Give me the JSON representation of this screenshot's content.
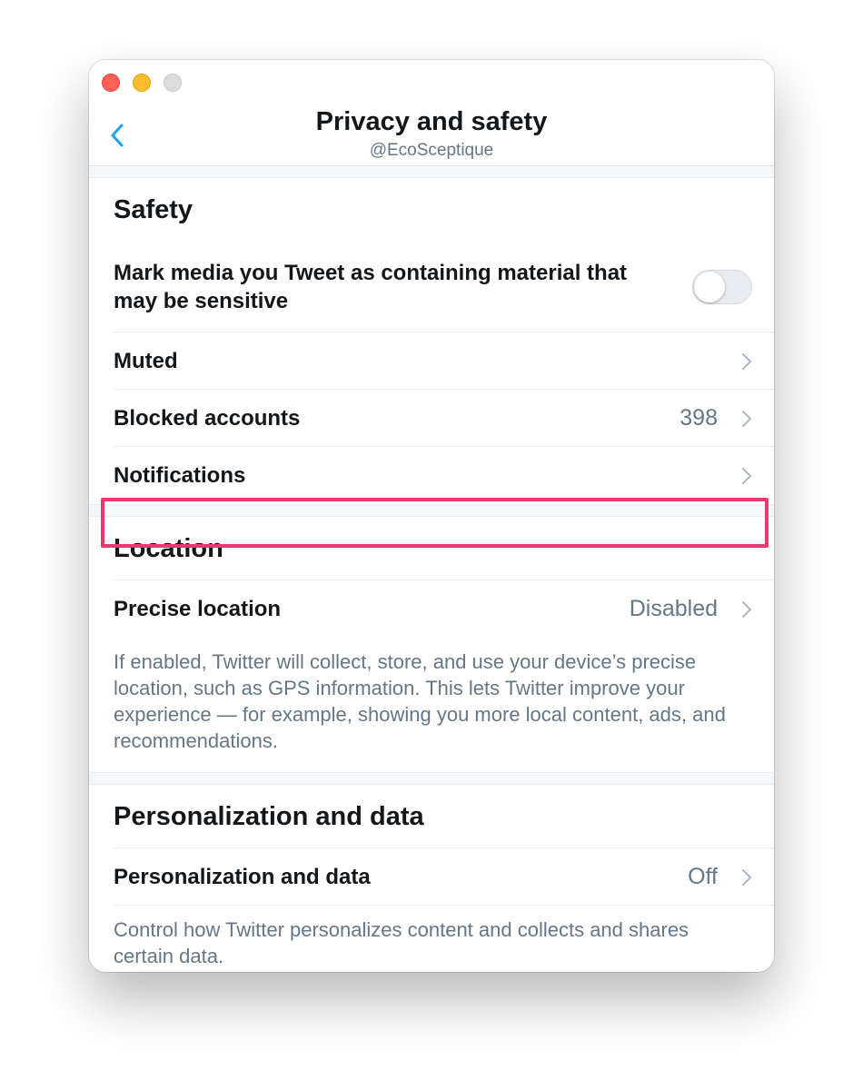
{
  "header": {
    "title": "Privacy and safety",
    "subtitle": "@EcoSceptique"
  },
  "safety": {
    "heading": "Safety",
    "sensitive_media": {
      "label": "Mark media you Tweet as containing material that may be sensitive",
      "enabled": false
    },
    "muted_label": "Muted",
    "blocked_label": "Blocked accounts",
    "blocked_count": "398",
    "notifications_label": "Notifications"
  },
  "location": {
    "heading": "Location",
    "precise_label": "Precise location",
    "precise_value": "Disabled",
    "description": "If enabled, Twitter will collect, store, and use your device’s precise location, such as GPS information. This lets Twitter improve your experience — for example, showing you more local content, ads, and recommendations."
  },
  "personalization": {
    "heading": "Personalization and data",
    "row_label": "Personalization and data",
    "row_value": "Off",
    "description": "Control how Twitter personalizes content and collects and shares certain data."
  },
  "colors": {
    "accent": "#1da1f2",
    "highlight_border": "#e83a6e",
    "secondary_text": "#657786"
  },
  "icons": {
    "back": "chevron-left-icon",
    "row_chevron": "chevron-right-icon"
  }
}
